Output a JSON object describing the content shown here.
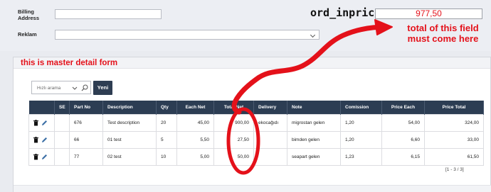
{
  "form": {
    "billing_address_label": "Billing Address",
    "billing_address_value": "",
    "reklam_label": "Reklam",
    "reklam_value": "",
    "ord_inprice_label": "ord_inprice",
    "ord_inprice_value": "977,50"
  },
  "annotations": {
    "total_note": "total of this field must come here",
    "master_detail_note": "this is master detail form",
    "color": "#e4111a"
  },
  "toolbar": {
    "search_placeholder": "Hızlı arama",
    "new_button_label": "Yeni"
  },
  "table": {
    "columns": [
      "",
      "SE",
      "Part No",
      "Description",
      "Qty",
      "Each Net",
      "Total Net",
      "Delivery",
      "Note",
      "Comission",
      "Price Each",
      "Price Total"
    ],
    "rows": [
      {
        "se": "",
        "part_no": "676",
        "description": "Test description",
        "qty": "20",
        "each_net": "45,00",
        "total_net": "900,00",
        "delivery": "ekocağıdı",
        "note": "migrostan gelen",
        "comission": "1,20",
        "price_each": "54,00",
        "price_total": "324,00"
      },
      {
        "se": "",
        "part_no": "66",
        "description": "01 test",
        "qty": "5",
        "each_net": "5,50",
        "total_net": "27,50",
        "delivery": "",
        "note": "bimden gelen",
        "comission": "1,20",
        "price_each": "6,60",
        "price_total": "33,00"
      },
      {
        "se": "",
        "part_no": "77",
        "description": "02 test",
        "qty": "10",
        "each_net": "5,00",
        "total_net": "50,00",
        "delivery": "",
        "note": "seapart gelen",
        "comission": "1,23",
        "price_each": "6,15",
        "price_total": "61,50"
      }
    ]
  },
  "pager": {
    "text": "[1 - 3 / 3]"
  },
  "colors": {
    "header_bg": "#2c3d53",
    "accent_red": "#e4111a"
  },
  "icons": [
    "search-icon",
    "chevron-down-icon",
    "trash-icon",
    "edit-icon",
    "arrow-annotation",
    "circle-annotation"
  ]
}
